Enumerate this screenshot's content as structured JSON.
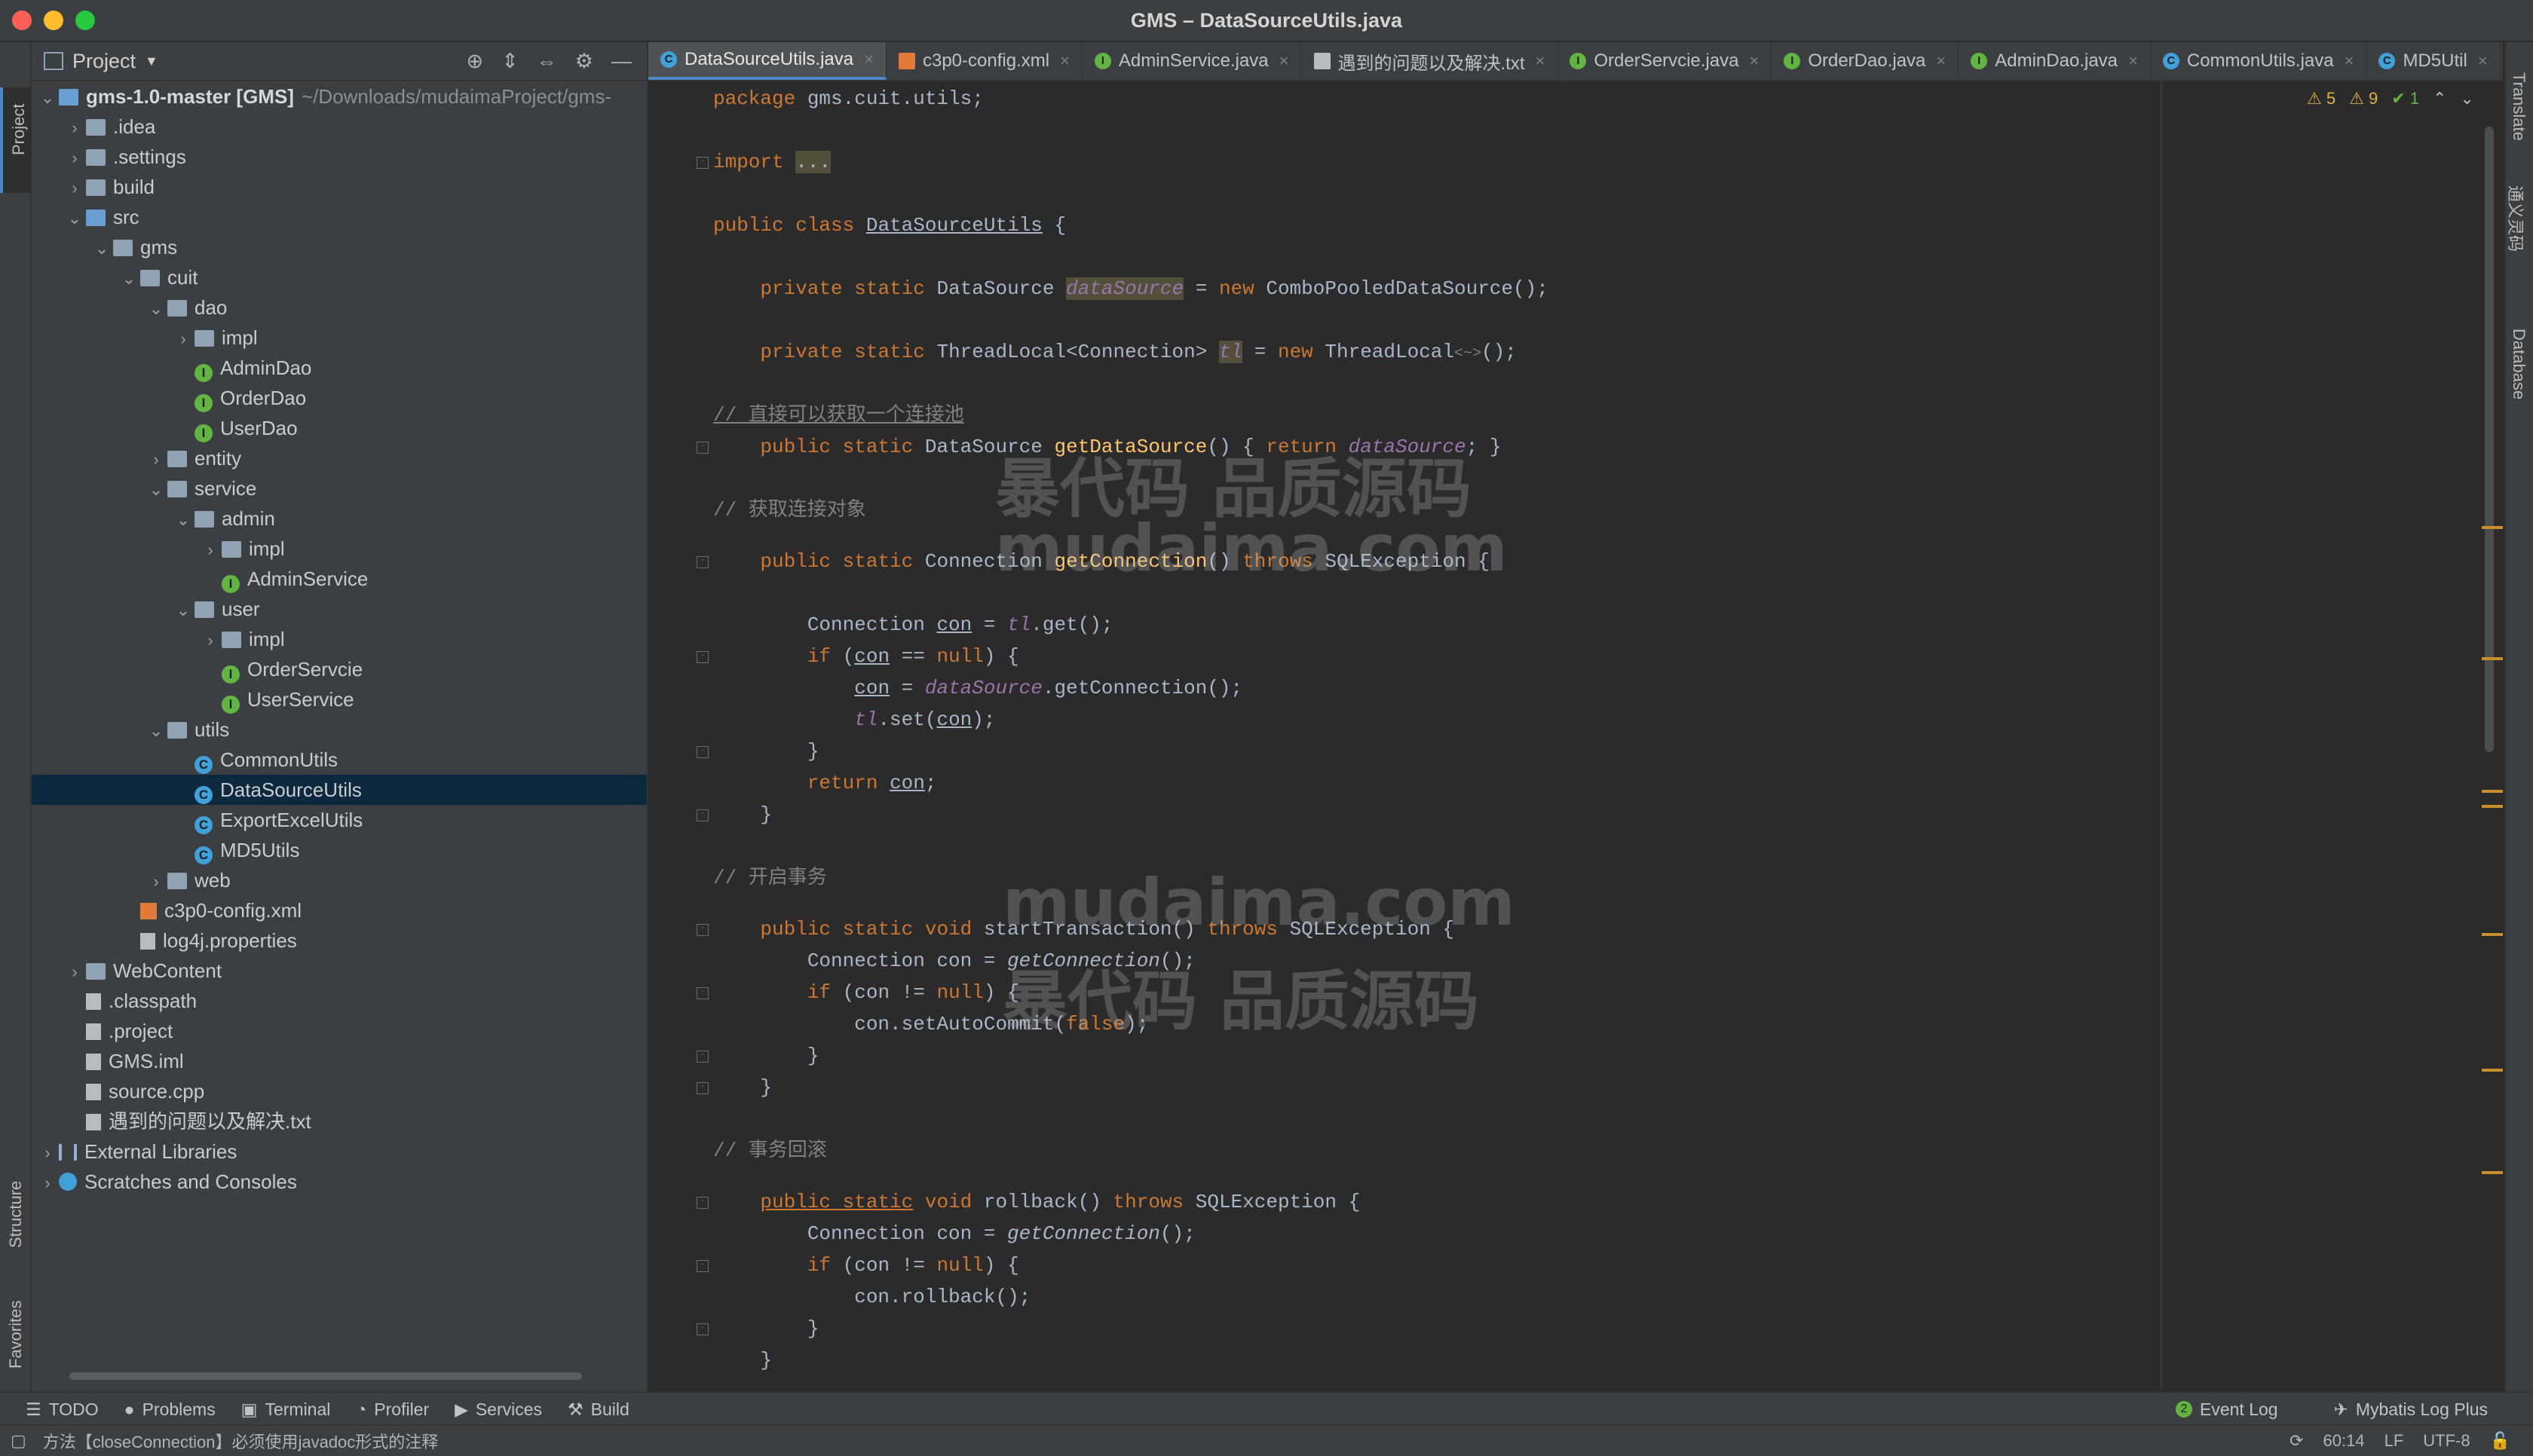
{
  "window": {
    "title": "GMS – DataSourceUtils.java"
  },
  "left_strip": {
    "project": "Project",
    "structure": "Structure",
    "favorites": "Favorites"
  },
  "right_strip": {
    "translate": "Translate",
    "tongyi": "通义灵码",
    "database": "Database"
  },
  "project_panel": {
    "title": "Project",
    "tree": [
      {
        "label": "gms-1.0-master [GMS]",
        "extra": "~/Downloads/mudaimaProject/gms-",
        "depth": 0,
        "arrow": "v",
        "icon": "folder-blue"
      },
      {
        "label": ".idea",
        "depth": 1,
        "arrow": ">",
        "icon": "folder"
      },
      {
        "label": ".settings",
        "depth": 1,
        "arrow": ">",
        "icon": "folder"
      },
      {
        "label": "build",
        "depth": 1,
        "arrow": ">",
        "icon": "folder"
      },
      {
        "label": "src",
        "depth": 1,
        "arrow": "v",
        "icon": "folder-blue"
      },
      {
        "label": "gms",
        "depth": 2,
        "arrow": "v",
        "icon": "folder"
      },
      {
        "label": "cuit",
        "depth": 3,
        "arrow": "v",
        "icon": "folder"
      },
      {
        "label": "dao",
        "depth": 4,
        "arrow": "v",
        "icon": "folder"
      },
      {
        "label": "impl",
        "depth": 5,
        "arrow": ">",
        "icon": "folder"
      },
      {
        "label": "AdminDao",
        "depth": 5,
        "arrow": "",
        "icon": "interface"
      },
      {
        "label": "OrderDao",
        "depth": 5,
        "arrow": "",
        "icon": "interface"
      },
      {
        "label": "UserDao",
        "depth": 5,
        "arrow": "",
        "icon": "interface"
      },
      {
        "label": "entity",
        "depth": 4,
        "arrow": ">",
        "icon": "folder"
      },
      {
        "label": "service",
        "depth": 4,
        "arrow": "v",
        "icon": "folder"
      },
      {
        "label": "admin",
        "depth": 5,
        "arrow": "v",
        "icon": "folder"
      },
      {
        "label": "impl",
        "depth": 6,
        "arrow": ">",
        "icon": "folder"
      },
      {
        "label": "AdminService",
        "depth": 6,
        "arrow": "",
        "icon": "interface"
      },
      {
        "label": "user",
        "depth": 5,
        "arrow": "v",
        "icon": "folder"
      },
      {
        "label": "impl",
        "depth": 6,
        "arrow": ">",
        "icon": "folder"
      },
      {
        "label": "OrderServcie",
        "depth": 6,
        "arrow": "",
        "icon": "interface"
      },
      {
        "label": "UserService",
        "depth": 6,
        "arrow": "",
        "icon": "interface"
      },
      {
        "label": "utils",
        "depth": 4,
        "arrow": "v",
        "icon": "folder"
      },
      {
        "label": "CommonUtils",
        "depth": 5,
        "arrow": "",
        "icon": "class"
      },
      {
        "label": "DataSourceUtils",
        "depth": 5,
        "arrow": "",
        "icon": "class",
        "selected": true
      },
      {
        "label": "ExportExcelUtils",
        "depth": 5,
        "arrow": "",
        "icon": "class"
      },
      {
        "label": "MD5Utils",
        "depth": 5,
        "arrow": "",
        "icon": "class"
      },
      {
        "label": "web",
        "depth": 4,
        "arrow": ">",
        "icon": "folder"
      },
      {
        "label": "c3p0-config.xml",
        "depth": 3,
        "arrow": "",
        "icon": "xml"
      },
      {
        "label": "log4j.properties",
        "depth": 3,
        "arrow": "",
        "icon": "file"
      },
      {
        "label": "WebContent",
        "depth": 1,
        "arrow": ">",
        "icon": "folder"
      },
      {
        "label": ".classpath",
        "depth": 1,
        "arrow": "",
        "icon": "file"
      },
      {
        "label": ".project",
        "depth": 1,
        "arrow": "",
        "icon": "file"
      },
      {
        "label": "GMS.iml",
        "depth": 1,
        "arrow": "",
        "icon": "file"
      },
      {
        "label": "source.cpp",
        "depth": 1,
        "arrow": "",
        "icon": "file"
      },
      {
        "label": "遇到的问题以及解决.txt",
        "depth": 1,
        "arrow": "",
        "icon": "file"
      },
      {
        "label": "External Libraries",
        "depth": 0,
        "arrow": ">",
        "icon": "library"
      },
      {
        "label": "Scratches and Consoles",
        "depth": 0,
        "arrow": ">",
        "icon": "scratch"
      }
    ]
  },
  "tabs": [
    {
      "label": "DataSourceUtils.java",
      "icon": "class",
      "active": true
    },
    {
      "label": "c3p0-config.xml",
      "icon": "xml"
    },
    {
      "label": "AdminService.java",
      "icon": "interface"
    },
    {
      "label": "遇到的问题以及解决.txt",
      "icon": "file"
    },
    {
      "label": "OrderServcie.java",
      "icon": "interface"
    },
    {
      "label": "OrderDao.java",
      "icon": "interface"
    },
    {
      "label": "AdminDao.java",
      "icon": "interface"
    },
    {
      "label": "CommonUtils.java",
      "icon": "class"
    },
    {
      "label": "MD5Util",
      "icon": "class"
    }
  ],
  "inspections": {
    "weak_warnings": "5",
    "warnings": "9",
    "ok": "1"
  },
  "code": {
    "l1": "package gms.cuit.utils;",
    "l2_kw": "import",
    "l2_rest": "...",
    "l3": "DataSourceUtils",
    "c1": "// 直接可以获取一个连接池",
    "c2": "// 获取连接对象",
    "c3": "// 开启事务",
    "c4": "// 事务回滚"
  },
  "watermarks": [
    "暴代码 品质源码",
    "mudaima.com",
    "mudaima.com",
    "暴代码 品质源码"
  ],
  "bottom_tools": [
    "TODO",
    "Problems",
    "Terminal",
    "Profiler",
    "Services",
    "Build"
  ],
  "bottom_right": {
    "event_log": "Event Log",
    "event_count": "2",
    "mybatis": "Mybatis Log Plus"
  },
  "status": {
    "message": "方法【closeConnection】必须使用javadoc形式的注释",
    "position": "60:14",
    "line_sep": "LF",
    "encoding": "UTF-8"
  }
}
